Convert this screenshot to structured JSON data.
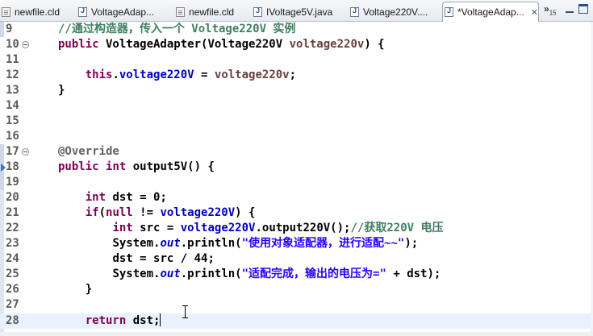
{
  "tabs": [
    {
      "label": "newfile.cld",
      "icon": "cld-file-icon",
      "active": false
    },
    {
      "label": "VoltageAdap...",
      "icon": "java-file-icon",
      "active": false
    },
    {
      "label": "newfile.cld",
      "icon": "cld-file-icon",
      "active": false
    },
    {
      "label": "IVoltage5V.java",
      "icon": "java-file-icon",
      "active": false
    },
    {
      "label": "Voltage220V....",
      "icon": "java-file-icon",
      "active": false
    },
    {
      "label": "*VoltageAdap...",
      "icon": "java-file-icon",
      "active": true
    }
  ],
  "active_tab_close": "✕",
  "overflow": {
    "chevron": "»",
    "count": "15"
  },
  "lines": [
    {
      "n": "9",
      "fold": false,
      "override": false,
      "current": false
    },
    {
      "n": "10",
      "fold": true,
      "override": false,
      "current": false
    },
    {
      "n": "11",
      "fold": false,
      "override": false,
      "current": false
    },
    {
      "n": "12",
      "fold": false,
      "override": false,
      "current": false
    },
    {
      "n": "13",
      "fold": false,
      "override": false,
      "current": false
    },
    {
      "n": "14",
      "fold": false,
      "override": false,
      "current": false
    },
    {
      "n": "15",
      "fold": false,
      "override": false,
      "current": false
    },
    {
      "n": "16",
      "fold": false,
      "override": false,
      "current": false
    },
    {
      "n": "17",
      "fold": true,
      "override": false,
      "current": false
    },
    {
      "n": "18",
      "fold": false,
      "override": true,
      "current": false
    },
    {
      "n": "19",
      "fold": false,
      "override": false,
      "current": false
    },
    {
      "n": "20",
      "fold": false,
      "override": false,
      "current": false
    },
    {
      "n": "21",
      "fold": false,
      "override": false,
      "current": false
    },
    {
      "n": "22",
      "fold": false,
      "override": false,
      "current": false
    },
    {
      "n": "23",
      "fold": false,
      "override": false,
      "current": false
    },
    {
      "n": "24",
      "fold": false,
      "override": false,
      "current": false
    },
    {
      "n": "25",
      "fold": false,
      "override": false,
      "current": false
    },
    {
      "n": "26",
      "fold": false,
      "override": false,
      "current": false
    },
    {
      "n": "27",
      "fold": false,
      "override": false,
      "current": false
    },
    {
      "n": "28",
      "fold": false,
      "override": false,
      "current": true
    }
  ],
  "code": {
    "l9_comment": "//通过构造器，传入一个 Voltage220V 实例",
    "l10_public": "public",
    "l10_sig1": " VoltageAdapter(Voltage220V ",
    "l10_param": "voltage220v",
    "l10_sig2": ") {",
    "l12_indent": "    ",
    "l12_this": "this",
    "l12_dot": ".",
    "l12_field": "voltage220V",
    "l12_assign": " = ",
    "l12_param": "voltage220v",
    "l12_end": ";",
    "l13_brace": "}",
    "l17_ann": "@Override",
    "l18_public": "public",
    "l18_sp": " ",
    "l18_int": "int",
    "l18_rest": " output5V() {",
    "l20_indent": "    ",
    "l20_int": "int",
    "l20_rest": " dst = 0;",
    "l21_indent": "    ",
    "l21_if": "if",
    "l21_open": "(",
    "l21_null": "null",
    "l21_ne": " != ",
    "l21_field": "voltage220V",
    "l21_close": ") {",
    "l22_indent": "        ",
    "l22_int": "int",
    "l22_mid": " src = ",
    "l22_field": "voltage220V",
    "l22_call": ".output220V();",
    "l22_comment": "//获取220V 电压",
    "l23_indent": "        ",
    "l23_system": "System.",
    "l23_out": "out",
    "l23_println": ".println(",
    "l23_str": "\"使用对象适配器，进行适配~~\"",
    "l23_end": ");",
    "l24_indent": "        ",
    "l24_code": "dst = src / 44;",
    "l25_indent": "        ",
    "l25_system": "System.",
    "l25_out": "out",
    "l25_println": ".println(",
    "l25_str": "\"适配完成，输出的电压为=\"",
    "l25_end": " + dst);",
    "l26_indent": "    ",
    "l26_brace": "}",
    "l28_indent": "    ",
    "l28_return": "return",
    "l28_rest": " dst;"
  },
  "colors": {
    "keyword": "#7f0055",
    "field": "#0000c0",
    "comment": "#3f7f5f",
    "string": "#2a00ff",
    "annotation": "#646464",
    "current_line": "#e8f2fe"
  }
}
